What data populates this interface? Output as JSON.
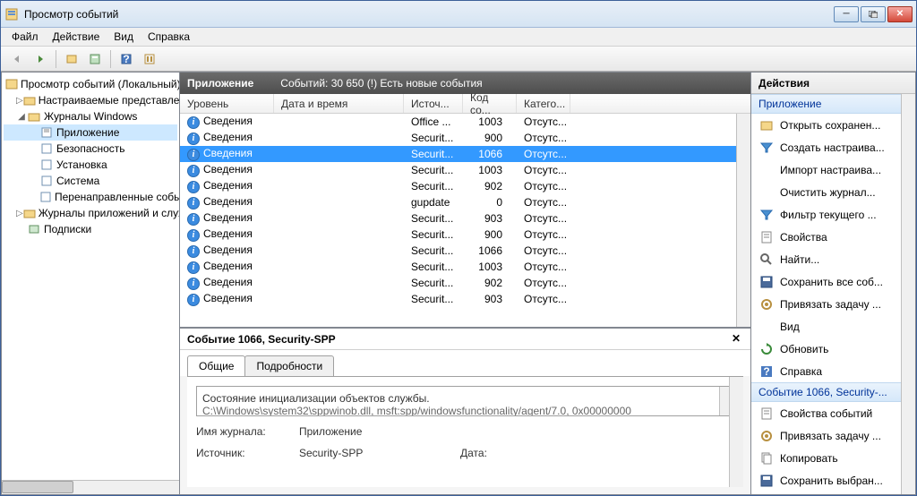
{
  "title": "Просмотр событий",
  "menu": [
    "Файл",
    "Действие",
    "Вид",
    "Справка"
  ],
  "tree": {
    "root": "Просмотр событий (Локальный)",
    "custom_views": "Настраиваемые представления",
    "win_logs": "Журналы Windows",
    "app": "Приложение",
    "security": "Безопасность",
    "setup": "Установка",
    "system": "Система",
    "forwarded": "Перенаправленные события",
    "app_svc": "Журналы приложений и служб",
    "subs": "Подписки"
  },
  "center": {
    "title": "Приложение",
    "count_label": "Событий: 30 650 (!) Есть новые события",
    "cols": {
      "level": "Уровень",
      "datetime": "Дата и время",
      "source": "Источ...",
      "code": "Код со...",
      "category": "Катего..."
    },
    "rows": [
      {
        "level": "Сведения",
        "source": "Securit...",
        "code": "903",
        "cat": "Отсутс..."
      },
      {
        "level": "Сведения",
        "source": "Securit...",
        "code": "902",
        "cat": "Отсутс..."
      },
      {
        "level": "Сведения",
        "source": "Securit...",
        "code": "1003",
        "cat": "Отсутс..."
      },
      {
        "level": "Сведения",
        "source": "Securit...",
        "code": "1066",
        "cat": "Отсутс..."
      },
      {
        "level": "Сведения",
        "source": "Securit...",
        "code": "900",
        "cat": "Отсутс..."
      },
      {
        "level": "Сведения",
        "source": "Securit...",
        "code": "903",
        "cat": "Отсутс..."
      },
      {
        "level": "Сведения",
        "source": "gupdate",
        "code": "0",
        "cat": "Отсутс..."
      },
      {
        "level": "Сведения",
        "source": "Securit...",
        "code": "902",
        "cat": "Отсутс..."
      },
      {
        "level": "Сведения",
        "source": "Securit...",
        "code": "1003",
        "cat": "Отсутс..."
      },
      {
        "level": "Сведения",
        "source": "Securit...",
        "code": "1066",
        "cat": "Отсутс..."
      },
      {
        "level": "Сведения",
        "source": "Securit...",
        "code": "900",
        "cat": "Отсутс..."
      },
      {
        "level": "Сведения",
        "source": "Office ...",
        "code": "1003",
        "cat": "Отсутс..."
      }
    ],
    "selected": 9
  },
  "detail": {
    "title": "Событие 1066, Security-SPP",
    "tabs": {
      "general": "Общие",
      "details": "Подробности"
    },
    "desc1": "Состояние инициализации объектов службы.",
    "desc2": "C:\\Windows\\system32\\sppwinob.dll, msft:spp/windowsfunctionality/agent/7.0, 0x00000000",
    "log_label": "Имя журнала:",
    "log_value": "Приложение",
    "source_label": "Источник:",
    "source_value": "Security-SPP",
    "date_label": "Дата:"
  },
  "actions": {
    "title": "Действия",
    "group_app": "Приложение",
    "items_app": [
      "Открыть сохранен...",
      "Создать настраива...",
      "Импорт настраива...",
      "Очистить журнал...",
      "Фильтр текущего ...",
      "Свойства",
      "Найти...",
      "Сохранить все соб...",
      "Привязать задачу ...",
      "Вид",
      "Обновить",
      "Справка"
    ],
    "group_event": "Событие 1066, Security-...",
    "items_event": [
      "Свойства событий",
      "Привязать задачу ...",
      "Копировать",
      "Сохранить выбран..."
    ]
  }
}
